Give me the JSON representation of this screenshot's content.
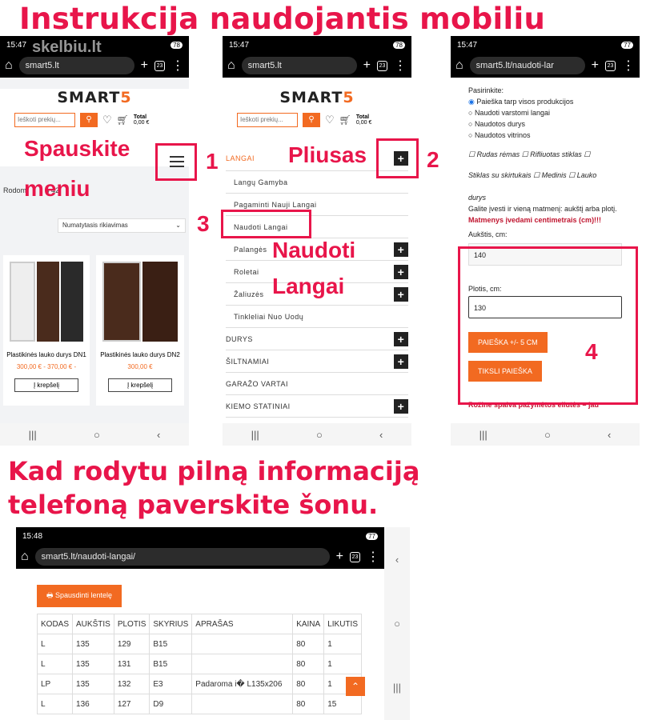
{
  "headings": {
    "top": "Instrukcija naudojantis mobiliu telefonu",
    "bottom1": "Kad rodytu pilną informaciją",
    "bottom2": "telefoną paverskite šonu."
  },
  "p1": {
    "time": "15:47",
    "battery": "78",
    "url": "smart5.lt",
    "watermark": "skelbiu.lt",
    "search_ph": "Ieškoti prekių...",
    "total_label": "Total",
    "total_val": "0,00 €",
    "sort": "Numatytasis rikiavimas",
    "showing": "Rodom",
    "showing2": "s 42",
    "products": [
      {
        "name": "Plastikinės lauko durys DN1",
        "price": "300,00 € - 370,00 € -",
        "btn": "Į krepšelį"
      },
      {
        "name": "Plastikinės lauko durys DN2",
        "price": "300,00 €",
        "btn": "Į krepšelį"
      }
    ]
  },
  "p2": {
    "time": "15:47",
    "battery": "78",
    "url": "smart5.lt",
    "menu": [
      {
        "label": "LANGAI",
        "plus": "true"
      },
      {
        "label": "Langų Gamyba"
      },
      {
        "label": "Pagaminti Nauji Langai"
      },
      {
        "label": "Naudoti Langai"
      },
      {
        "label": "Palangės",
        "plus": "true"
      },
      {
        "label": "Roletai",
        "plus": "true"
      },
      {
        "label": "Žaliuzės",
        "plus": "true"
      },
      {
        "label": "Tinkleliai Nuo Uodų"
      },
      {
        "label": "DURYS",
        "plus": "true"
      },
      {
        "label": "ŠILTNAMIAI",
        "plus": "true"
      },
      {
        "label": "GARAŽO VARTAI"
      },
      {
        "label": "KIEMO STATINIAI",
        "plus": "true"
      }
    ]
  },
  "p3": {
    "time": "15:47",
    "battery": "77",
    "url": "smart5.lt/naudoti-lar",
    "choose": "Pasirinkite:",
    "radios": [
      "Paieška tarp visos produkcijos",
      "Naudoti varstomi langai",
      "Naudotos durys",
      "Naudotos vitrinos"
    ],
    "chk1": "Rudas rėmas",
    "chk2": "Rifliuotas stiklas",
    "chk3": "Stiklas su skirtukais",
    "chk4": "Medinis",
    "chk5": "Lauko",
    "durys": "durys",
    "info": "Galite įvesti ir vieną matmenį: aukštį arba plotį.",
    "red": "Matmenys įvedami centimetrais (cm)!!!",
    "h_label": "Aukštis, cm:",
    "h_val": "140",
    "w_label": "Plotis, cm:",
    "w_val": "130",
    "btn1": "PAIEŠKA +/- 5 CM",
    "btn2": "TIKSLI PAIEŠKA",
    "footer": "Rožine spalva pažymėtos eilutės – jau"
  },
  "p4": {
    "time": "15:48",
    "battery": "77",
    "url": "smart5.lt/naudoti-langai/",
    "print": "Spausdinti lentelę",
    "headers": [
      "KODAS",
      "AUKŠTIS",
      "PLOTIS",
      "SKYRIUS",
      "APRAŠAS",
      "KAINA",
      "LIKUTIS"
    ],
    "rows": [
      [
        "L",
        "135",
        "129",
        "B15",
        "",
        "80",
        "1"
      ],
      [
        "L",
        "135",
        "131",
        "B15",
        "",
        "80",
        "1"
      ],
      [
        "LP",
        "135",
        "132",
        "E3",
        "Padaroma i� L135x206",
        "80",
        "1"
      ],
      [
        "L",
        "136",
        "127",
        "D9",
        "",
        "80",
        "15"
      ]
    ]
  },
  "labels": {
    "l1": "Spauskite",
    "l1b": "meniu",
    "n1": "1",
    "l2": "Pliusas",
    "n2": "2",
    "n3": "3",
    "l3a": "Naudoti",
    "l3b": "Langai",
    "n4": "4"
  }
}
